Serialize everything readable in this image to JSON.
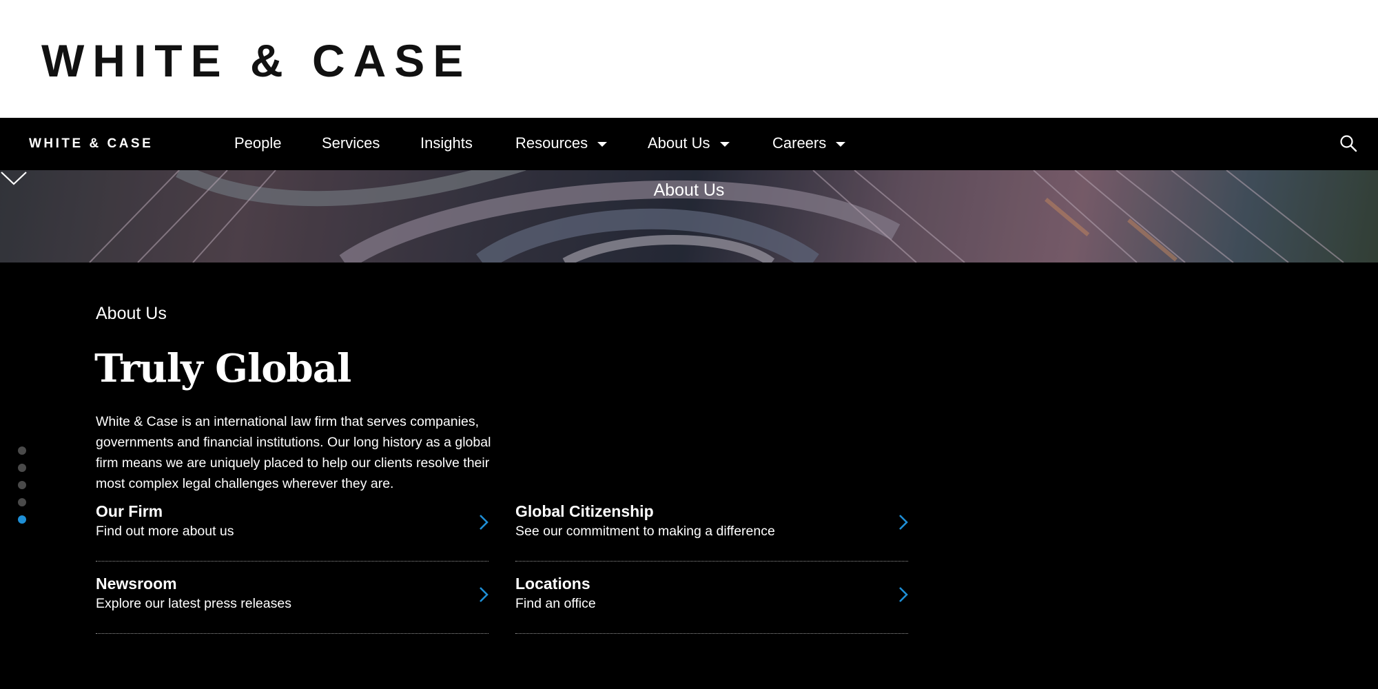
{
  "brand": {
    "logo_text": "WHITE & CASE",
    "logo_small_text": "WHITE & CASE"
  },
  "nav": {
    "items": [
      {
        "label": "People",
        "has_dropdown": false
      },
      {
        "label": "Services",
        "has_dropdown": false
      },
      {
        "label": "Insights",
        "has_dropdown": false
      },
      {
        "label": "Resources",
        "has_dropdown": true
      },
      {
        "label": "About Us",
        "has_dropdown": true
      },
      {
        "label": "Careers",
        "has_dropdown": true
      }
    ],
    "search_icon": "search-icon"
  },
  "hero": {
    "title": "About Us",
    "scroll_icon": "chevron-down-icon"
  },
  "main": {
    "eyebrow": "About Us",
    "headline": "Truly Global",
    "intro": "White & Case is an international law firm that serves companies, governments and financial institutions. Our long history as a global firm means we are uniquely placed to help our clients resolve their most complex legal challenges wherever they are.",
    "links": [
      {
        "title": "Our Firm",
        "subtitle": "Find out more about us"
      },
      {
        "title": "Global Citizenship",
        "subtitle": "See our commitment to making a difference"
      },
      {
        "title": "Newsroom",
        "subtitle": "Explore our latest press releases"
      },
      {
        "title": "Locations",
        "subtitle": "Find an office"
      }
    ]
  },
  "pagination": {
    "total": 5,
    "active_index": 4
  },
  "colors": {
    "accent": "#1e8fd6",
    "background": "#000000",
    "header": "#ffffff"
  }
}
